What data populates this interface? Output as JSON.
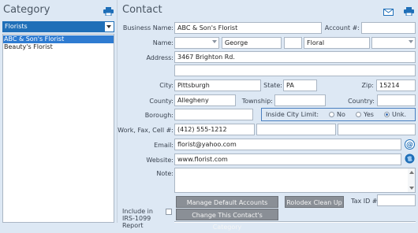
{
  "left": {
    "title": "Category",
    "category_select": "Florists",
    "items": [
      "ABC & Son's Florist",
      "Beauty's Florist"
    ]
  },
  "contact": {
    "title": "Contact",
    "labels": {
      "business_name": "Business Name:",
      "account": "Account #:",
      "name": "Name:",
      "address": "Address:",
      "city": "City:",
      "state": "State:",
      "zip": "Zip:",
      "county": "County:",
      "township": "Township:",
      "country": "Country:",
      "borough": "Borough:",
      "inside_city": "Inside City Limit:",
      "phones": "Work, Fax, Cell #:",
      "email": "Email:",
      "website": "Website:",
      "note": "Note:",
      "tax_id": "Tax ID #:",
      "irs": "Include in IRS-1099 Report"
    },
    "values": {
      "business_name": "ABC & Son's Florist",
      "account": "",
      "name_prefix": "",
      "first_name": "George",
      "middle": "",
      "last_name": "Floral",
      "suffix": "",
      "address1": "3467 Brighton Rd.",
      "address2": "",
      "city": "Pittsburgh",
      "state": "PA",
      "zip": "15214",
      "county": "Allegheny",
      "township": "",
      "country": "",
      "borough": "",
      "work_phone": "(412) 555-1212",
      "fax": "",
      "cell": "",
      "email": "florist@yahoo.com",
      "website": "www.florist.com",
      "note": "",
      "tax_id": ""
    },
    "inside_city_options": [
      "No",
      "Yes",
      "Unk."
    ],
    "inside_city_selected": "Unk.",
    "buttons": {
      "manage_accounts": "Manage Default Accounts",
      "rolodex": "Rolodex Clean Up",
      "change_category": "Change This Contact's Category"
    }
  },
  "colors": {
    "accent": "#1f6fb8",
    "selection": "#2e7bd1",
    "button": "#8a8f96"
  }
}
